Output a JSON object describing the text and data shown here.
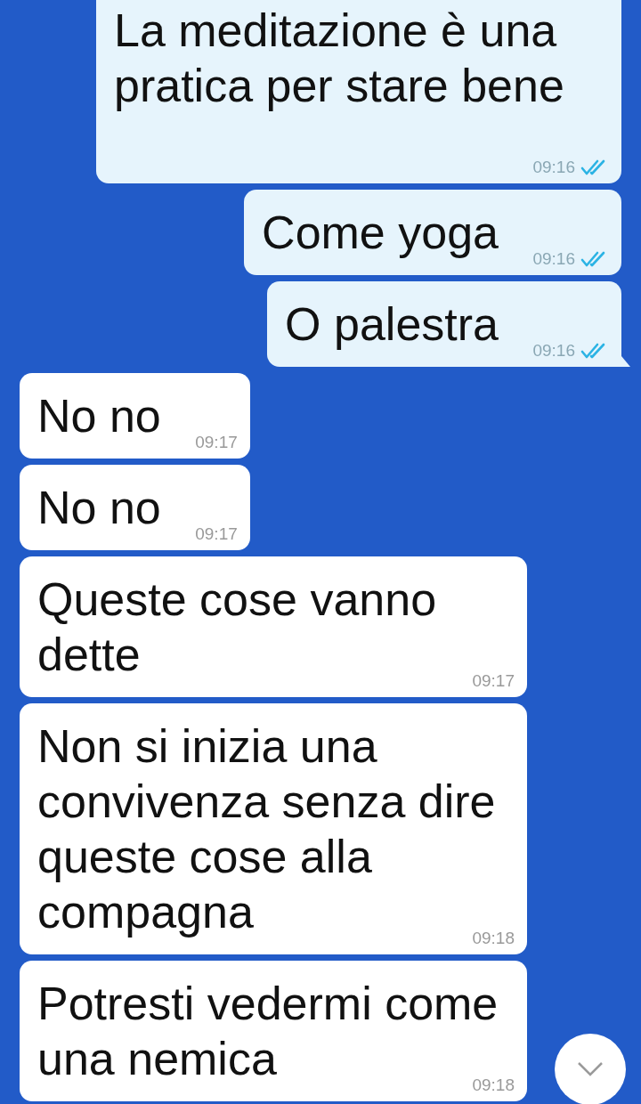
{
  "messages": [
    {
      "text": "La meditazione è una pratica per stare bene",
      "time": "09:16",
      "outgoing": true,
      "tail": false
    },
    {
      "text": "Come yoga",
      "time": "09:16",
      "outgoing": true,
      "tail": false
    },
    {
      "text": "O palestra",
      "time": "09:16",
      "outgoing": true,
      "tail": true
    },
    {
      "text": "No no",
      "time": "09:17",
      "outgoing": false,
      "tail": false
    },
    {
      "text": "No no",
      "time": "09:17",
      "outgoing": false,
      "tail": false
    },
    {
      "text": "Queste cose vanno dette",
      "time": "09:17",
      "outgoing": false,
      "tail": false
    },
    {
      "text": "Non si inizia una convivenza senza dire queste cose alla compagna",
      "time": "09:18",
      "outgoing": false,
      "tail": false
    },
    {
      "text": "Potresti vedermi come una nemica",
      "time": "09:18",
      "outgoing": false,
      "tail": false
    }
  ],
  "scroll_button": {
    "visible": true
  }
}
